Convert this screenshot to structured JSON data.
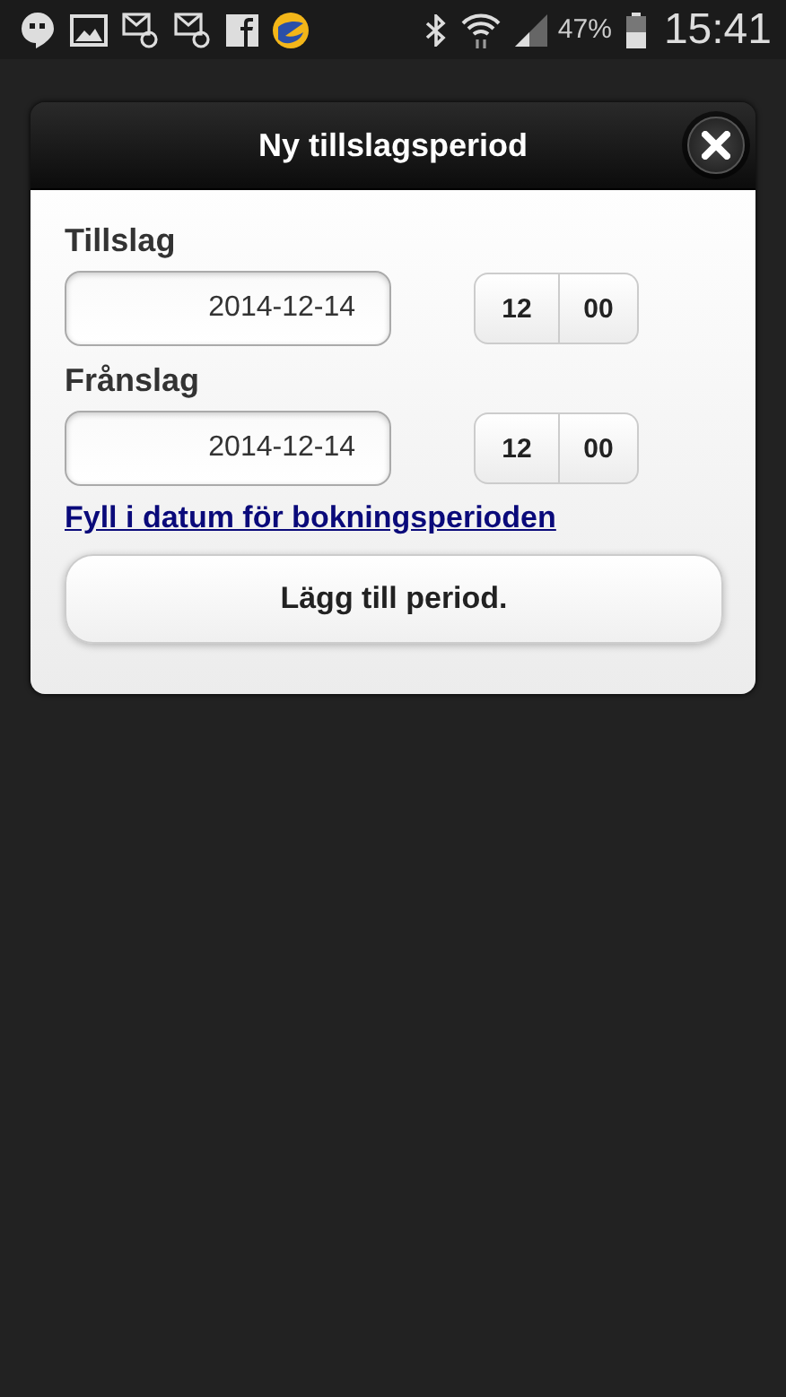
{
  "status_bar": {
    "battery": "47%",
    "time": "15:41"
  },
  "dialog": {
    "title": "Ny tillslagsperiod",
    "fields": [
      {
        "label": "Tillslag",
        "date": "2014-12-14",
        "hour": "12",
        "minute": "00"
      },
      {
        "label": "Frånslag",
        "date": "2014-12-14",
        "hour": "12",
        "minute": "00"
      }
    ],
    "link": "Fyll i datum för bokningsperioden",
    "button": "Lägg till period."
  }
}
